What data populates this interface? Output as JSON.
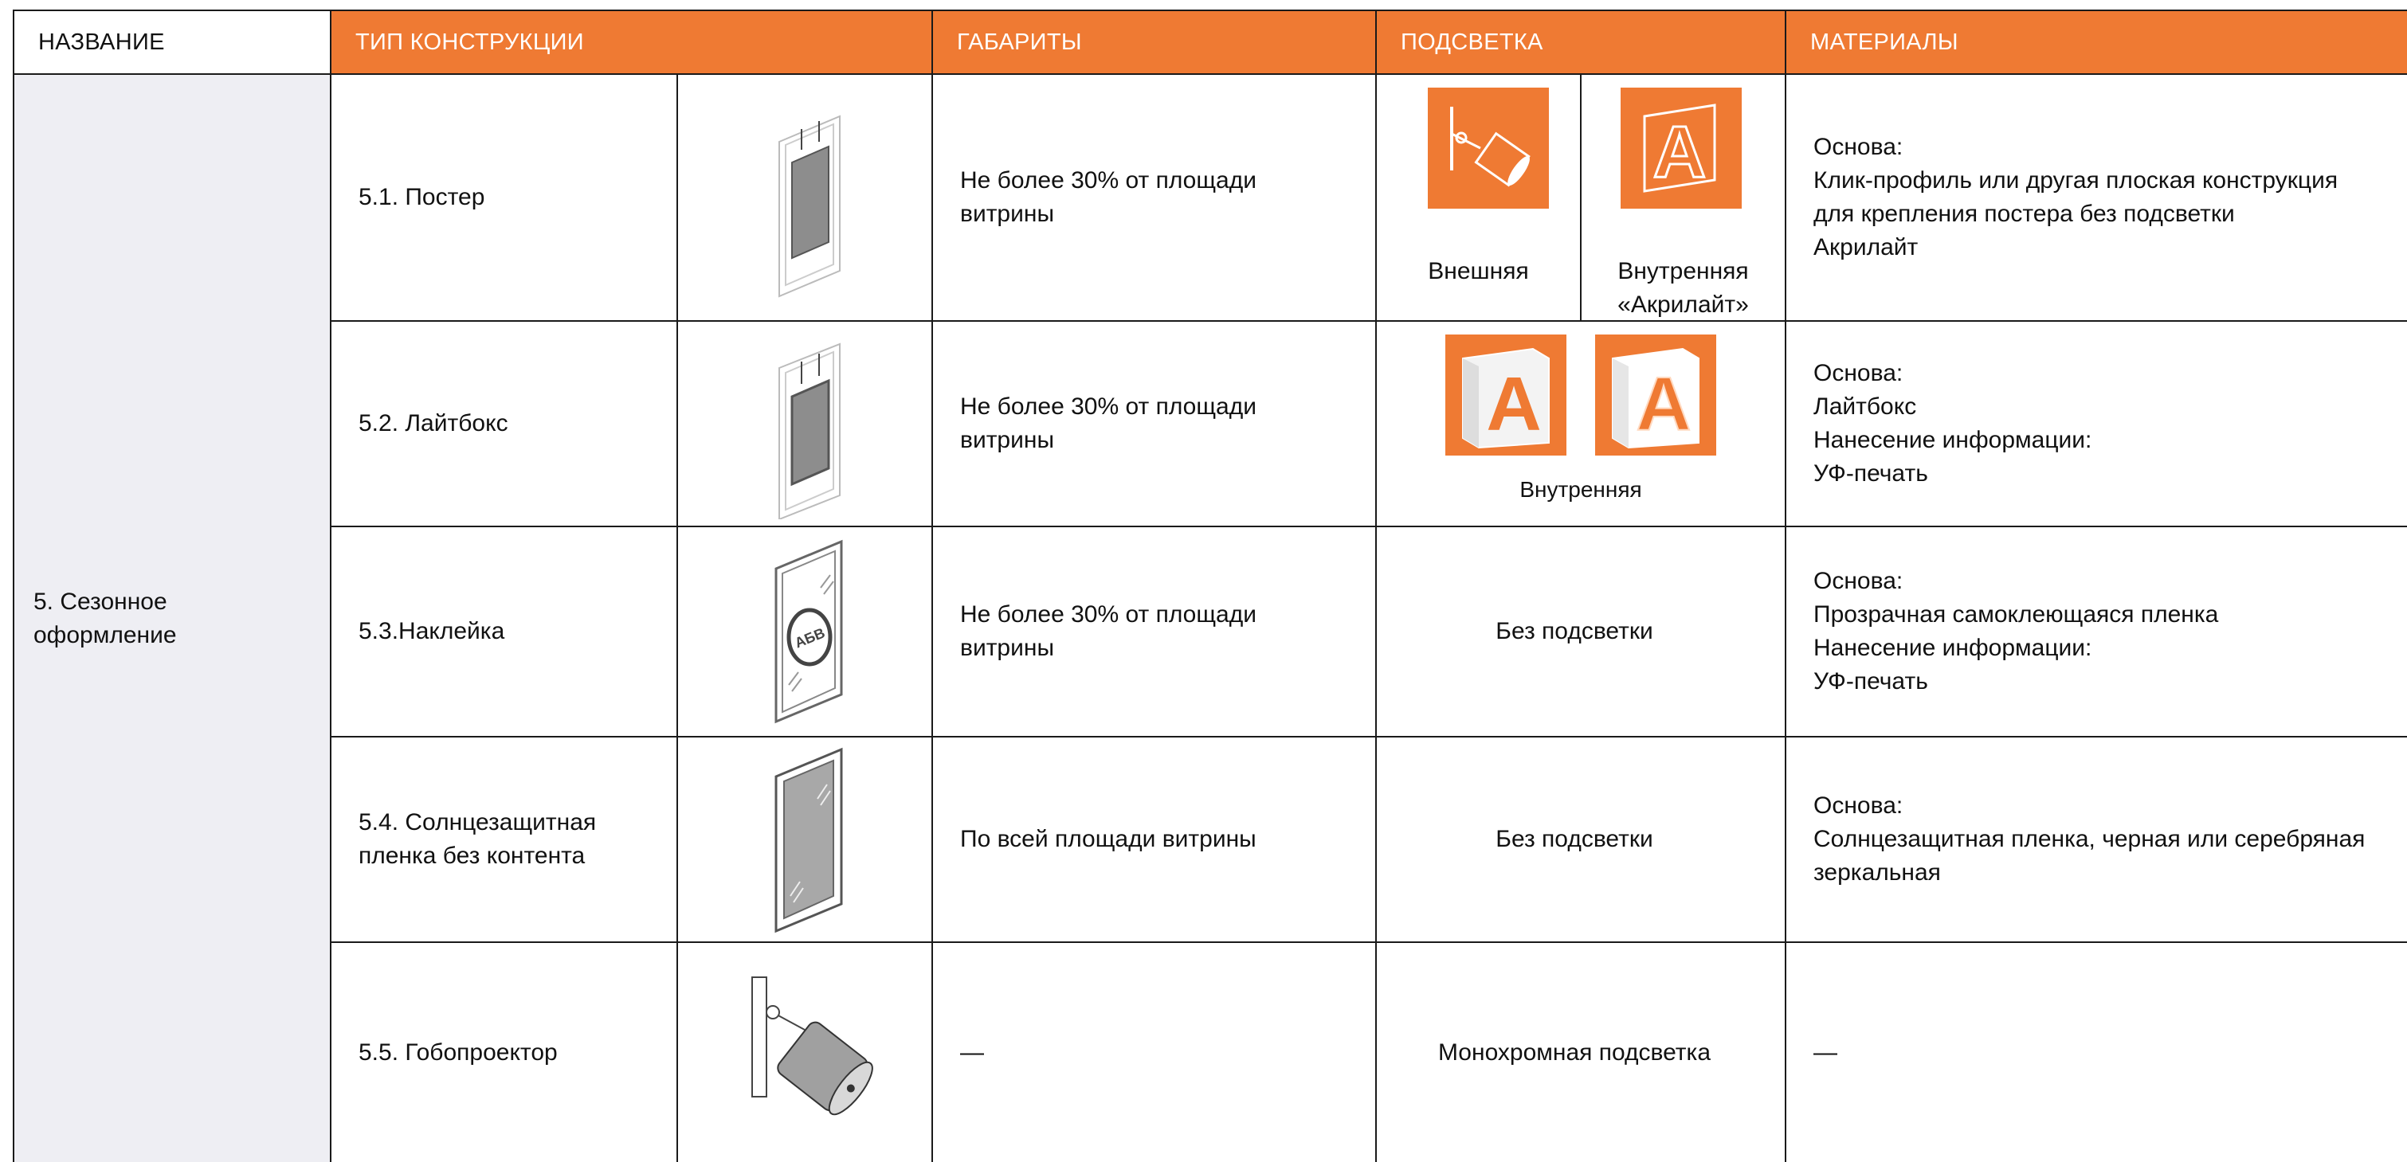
{
  "header": {
    "name": "НАЗВАНИЕ",
    "construction_type": "ТИП КОНСТРУКЦИИ",
    "dimensions": "ГАБАРИТЫ",
    "lighting": "ПОДСВЕТКА",
    "materials": "МАТЕРИАЛЫ"
  },
  "group_name": "5. Сезонное оформление",
  "rows": [
    {
      "type": "5.1. Постер",
      "icon": "poster-icon",
      "dimensions": "Не более 30% от площади витрины",
      "lighting_options": [
        {
          "icon": "spotlight-icon",
          "label": "Внешняя"
        },
        {
          "icon": "acrylight-letter-icon",
          "label": "Внутренняя «Акрилайт»"
        }
      ],
      "materials": [
        "Основа:",
        "Клик-профиль или другая плоская конструкция",
        "для крепления постера без подсветки",
        "Акрилайт"
      ]
    },
    {
      "type": "5.2. Лайтбокс",
      "icon": "lightbox-icon",
      "dimensions": "Не более 30% от площади витрины",
      "lighting_label": "Внутренняя",
      "lighting_icons": [
        "lightbox-letter-icon",
        "lightbox-letter-glow-icon"
      ],
      "materials": [
        "Основа:",
        "Лайтбокс",
        "Нанесение информации:",
        "УФ-печать"
      ]
    },
    {
      "type": "5.3.Наклейка",
      "icon": "sticker-icon",
      "sticker_text": "АБВ",
      "dimensions": "Не более 30% от площади витрины",
      "lighting": "Без подсветки",
      "materials": [
        "Основа:",
        "Прозрачная самоклеющаяся пленка",
        "Нанесение информации:",
        "УФ-печать"
      ]
    },
    {
      "type": "5.4. Солнцезащитная пленка без контента",
      "icon": "sun-film-icon",
      "dimensions": "По всей площади витрины",
      "lighting": "Без подсветки",
      "materials": [
        "Основа:",
        "Солнцезащитная пленка, черная или серебряная",
        "зеркальная"
      ]
    },
    {
      "type": "5.5. Гобопроектор",
      "icon": "gobo-projector-icon",
      "dimensions": "—",
      "lighting": "Монохромная подсветка",
      "materials": [
        "—"
      ]
    }
  ],
  "glyph": "A",
  "colors": {
    "accent": "#ef7a33",
    "name_column_bg": "#eeeef3",
    "border": "#1a1a1a"
  }
}
